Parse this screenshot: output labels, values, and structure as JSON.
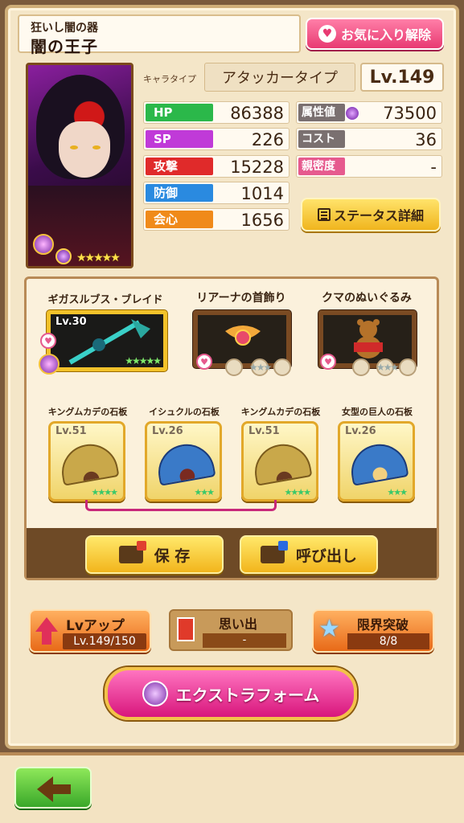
{
  "header": {
    "subtitle": "狂いし闇の器",
    "name": "闇の王子",
    "favorite_button": "お気に入り解除"
  },
  "portrait": {
    "rarity_stars": "★★★★★"
  },
  "char_type": {
    "label": "キャラタイプ",
    "value": "アタッカータイプ"
  },
  "level": "Lv.149",
  "stats": {
    "hp": {
      "label": "HP",
      "value": "86388",
      "color": "#2bb84a"
    },
    "sp": {
      "label": "SP",
      "value": "226",
      "color": "#c03ad8"
    },
    "atk": {
      "label": "攻撃",
      "value": "15228",
      "color": "#e02a2a"
    },
    "def": {
      "label": "防御",
      "value": "1014",
      "color": "#2a8ae0"
    },
    "crit": {
      "label": "会心",
      "value": "1656",
      "color": "#f08a1a"
    },
    "attr": {
      "label": "属性値",
      "value": "73500",
      "color": "#7a7070"
    },
    "cost": {
      "label": "コスト",
      "value": "36",
      "color": "#7a7070"
    },
    "affinity": {
      "label": "親密度",
      "value": "-",
      "color": "#e65a8e"
    }
  },
  "status_detail_button": "ステータス詳細",
  "equipment": [
    {
      "name": "ギガスルブス・ブレイド",
      "level": "Lv.30",
      "stars": "★★★★★",
      "icon": "sword-icon"
    },
    {
      "name": "リアーナの首飾り",
      "level": "",
      "stars": "★★★",
      "icon": "necklace-icon"
    },
    {
      "name": "クマのぬいぐるみ",
      "level": "",
      "stars": "★★★",
      "icon": "teddy-bear-icon"
    }
  ],
  "stones": [
    {
      "name": "キングムカデの石板",
      "level": "Lv.51",
      "stars": "★★★★",
      "style": "gold"
    },
    {
      "name": "イシュクルの石板",
      "level": "Lv.26",
      "stars": "★★★",
      "style": "blue"
    },
    {
      "name": "キングムカデの石板",
      "level": "Lv.51",
      "stars": "★★★★",
      "style": "gold"
    },
    {
      "name": "女型の巨人の石板",
      "level": "Lv.26",
      "stars": "★★★",
      "style": "blue2"
    }
  ],
  "actions": {
    "save": "保 存",
    "load": "呼び出し"
  },
  "lvup": {
    "label": "Lvアップ",
    "value": "Lv.149/150"
  },
  "memory": {
    "label": "思い出",
    "value": "-"
  },
  "limit": {
    "label": "限界突破",
    "value": "8/8"
  },
  "extra_form": "エクストラフォーム"
}
